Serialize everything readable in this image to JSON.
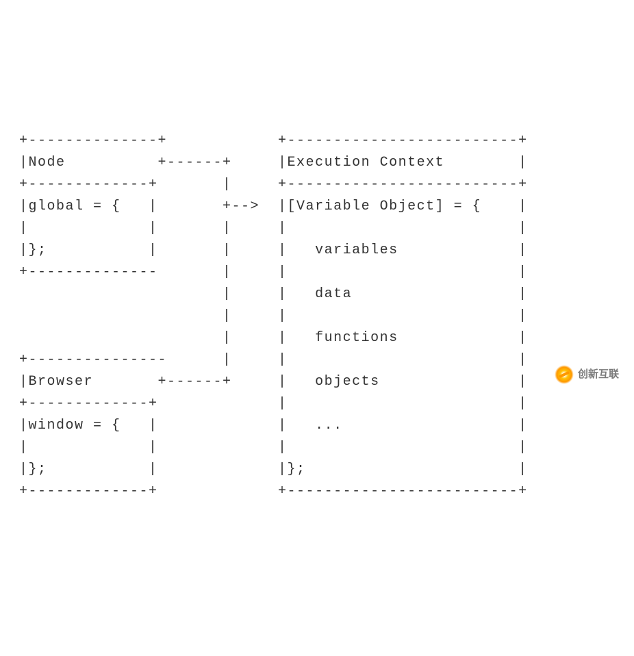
{
  "diagram": {
    "lines": [
      "+--------------+            +-------------------------+",
      "|Node          +------+     |Execution Context        |",
      "+-------------+       |     +-------------------------+",
      "|global = {   |       +-->  |[Variable Object] = {    |",
      "|             |       |     |                         |",
      "|};           |       |     |   variables             |",
      "+--------------       |     |                         |",
      "                      |     |   data                  |",
      "                      |     |                         |",
      "                      |     |   functions             |",
      "+---------------      |     |                         |",
      "|Browser       +------+     |   objects               |",
      "+-------------+             |                         |",
      "|window = {   |             |   ...                   |",
      "|             |             |                         |",
      "|};           |             |};                       |",
      "+-------------+             +-------------------------+"
    ],
    "node": {
      "title": "Node",
      "body": "global = {\n\n};"
    },
    "browser": {
      "title": "Browser",
      "body": "window = {\n\n};"
    },
    "execution_context": {
      "title": "Execution Context",
      "variable_object_label": "[Variable Object] = {",
      "items": [
        "variables",
        "data",
        "functions",
        "objects",
        "..."
      ],
      "close": "};"
    }
  },
  "watermark": {
    "text": "创新互联"
  }
}
